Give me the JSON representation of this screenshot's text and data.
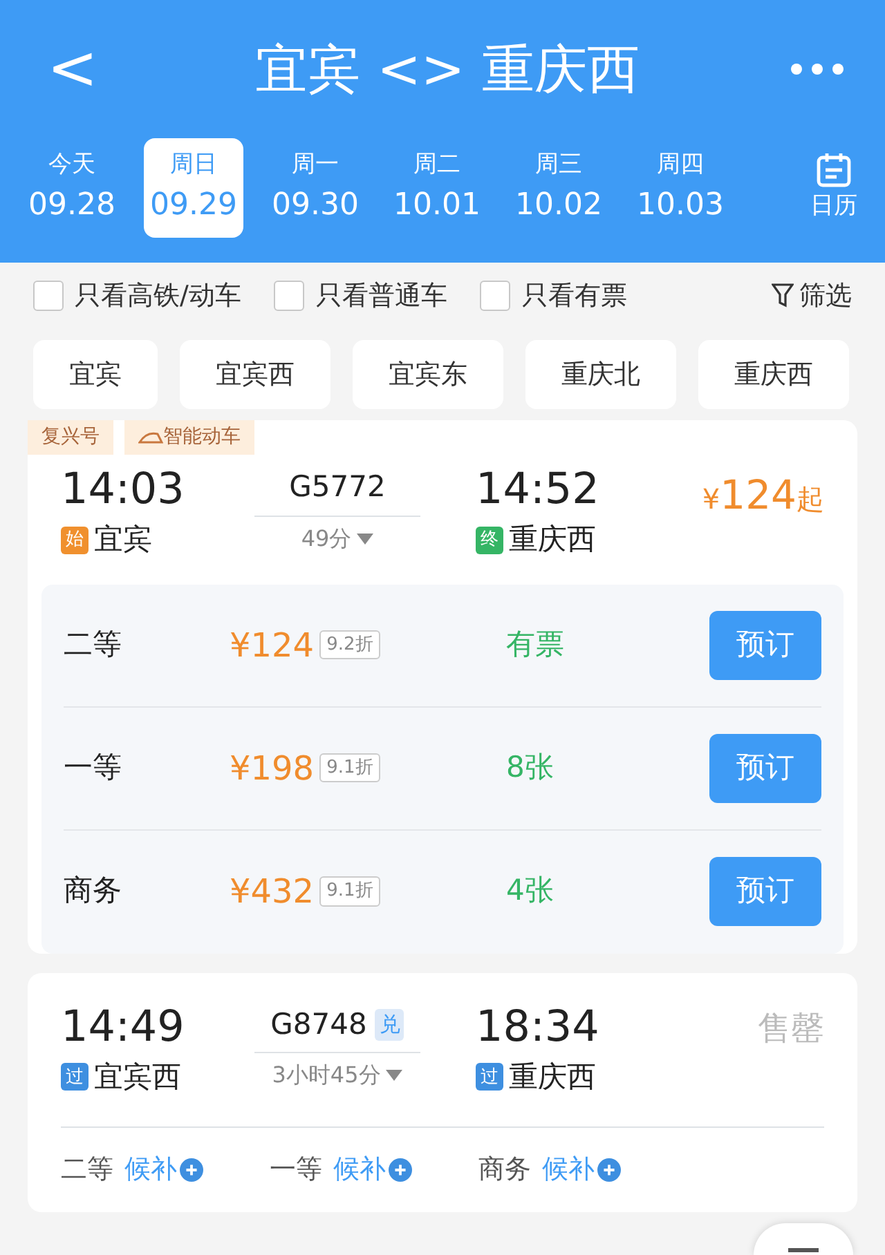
{
  "header": {
    "back": "<",
    "title": "宜宾 <> 重庆西"
  },
  "dates": [
    {
      "weekday": "今天",
      "date": "09.28",
      "selected": false
    },
    {
      "weekday": "周日",
      "date": "09.29",
      "selected": true
    },
    {
      "weekday": "周一",
      "date": "09.30",
      "selected": false
    },
    {
      "weekday": "周二",
      "date": "10.01",
      "selected": false
    },
    {
      "weekday": "周三",
      "date": "10.02",
      "selected": false
    },
    {
      "weekday": "周四",
      "date": "10.03",
      "selected": false
    }
  ],
  "calendar_label": "日历",
  "filters": [
    {
      "label": "只看高铁/动车",
      "checked": false
    },
    {
      "label": "只看普通车",
      "checked": false
    },
    {
      "label": "只看有票",
      "checked": false
    }
  ],
  "filter_button": "筛选",
  "stations": [
    "宜宾",
    "宜宾西",
    "宜宾东",
    "重庆北",
    "重庆西"
  ],
  "trains": [
    {
      "tags": [
        {
          "text": "复兴号",
          "icon": false
        },
        {
          "text": "智能动车",
          "icon": true
        }
      ],
      "depart_time": "14:03",
      "train_no": "G5772",
      "duration": "49分",
      "arrive_time": "14:52",
      "from": {
        "mark": "始",
        "kind": "start",
        "name": "宜宾"
      },
      "to": {
        "mark": "终",
        "kind": "end",
        "name": "重庆西"
      },
      "status": {
        "kind": "price",
        "currency": "¥",
        "amount": "124",
        "suffix": "起"
      },
      "seats": [
        {
          "kind": "detail",
          "class": "二等",
          "price": "¥124",
          "discount": "9.2折",
          "availability": "有票",
          "button": "预订"
        },
        {
          "kind": "detail",
          "class": "一等",
          "price": "¥198",
          "discount": "9.1折",
          "availability": "8张",
          "button": "预订"
        },
        {
          "kind": "detail",
          "class": "商务",
          "price": "¥432",
          "discount": "9.1折",
          "availability": "4张",
          "button": "预订"
        }
      ]
    },
    {
      "depart_time": "14:49",
      "train_no": "G8748",
      "train_badge": "兑",
      "duration": "3小时45分",
      "arrive_time": "18:34",
      "from": {
        "mark": "过",
        "kind": "pass",
        "name": "宜宾西"
      },
      "to": {
        "mark": "过",
        "kind": "pass",
        "name": "重庆西"
      },
      "status": {
        "kind": "sold_out",
        "text": "售罄"
      },
      "seats": [
        {
          "kind": "waitlist",
          "class": "二等",
          "action": "候补"
        },
        {
          "kind": "waitlist",
          "class": "一等",
          "action": "候补"
        },
        {
          "kind": "waitlist",
          "class": "商务",
          "action": "候补"
        }
      ]
    }
  ]
}
